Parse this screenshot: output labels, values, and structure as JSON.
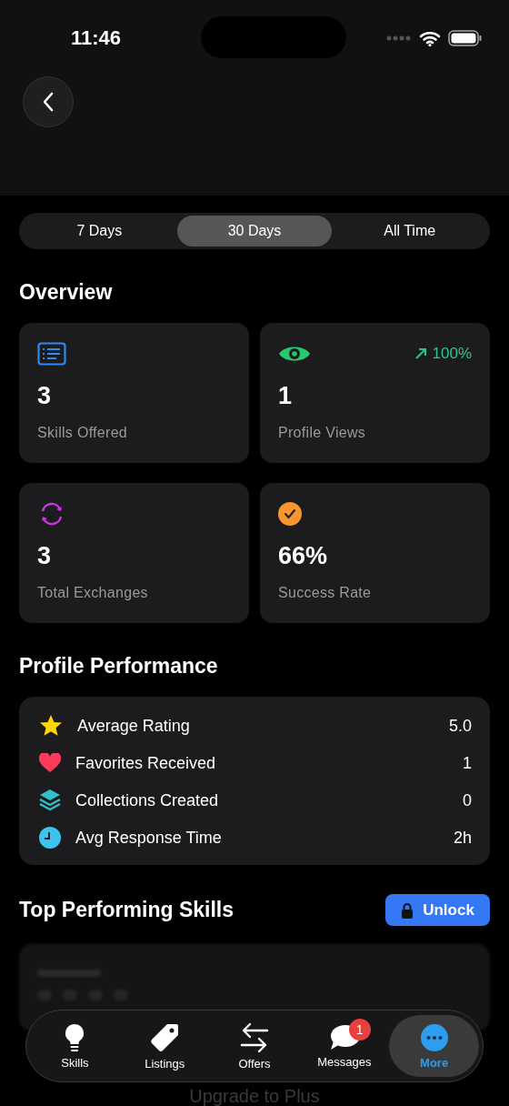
{
  "status_bar": {
    "time": "11:46"
  },
  "periods": [
    {
      "label": "7 Days",
      "selected": false
    },
    {
      "label": "30 Days",
      "selected": true
    },
    {
      "label": "All Time",
      "selected": false
    }
  ],
  "overview": {
    "title": "Overview",
    "stat_rows": [
      [
        {
          "kind": "list",
          "value": "3",
          "label": "Skills Offered"
        },
        {
          "kind": "eye",
          "value": "1",
          "label": "Profile Views",
          "trend": "100%"
        }
      ],
      [
        {
          "kind": "sync",
          "value": "3",
          "label": "Total Exchanges"
        },
        {
          "kind": "check",
          "value": "66%",
          "label": "Success Rate"
        }
      ]
    ]
  },
  "performance": {
    "title": "Profile Performance",
    "rows": [
      {
        "kind": "star",
        "label": "Average Rating",
        "value": "5.0"
      },
      {
        "kind": "heart",
        "label": "Favorites Received",
        "value": "1"
      },
      {
        "kind": "stack",
        "label": "Collections Created",
        "value": "0"
      },
      {
        "kind": "clock",
        "label": "Avg Response Time",
        "value": "2h"
      }
    ]
  },
  "top_skills": {
    "title": "Top Performing Skills",
    "unlock_label": "Unlock",
    "locked_message": "Upgrade to Plus"
  },
  "tab_bar": [
    {
      "kind": "bulb",
      "label": "Skills",
      "selected": false
    },
    {
      "kind": "tag",
      "label": "Listings",
      "selected": false
    },
    {
      "kind": "swap",
      "label": "Offers",
      "selected": false
    },
    {
      "kind": "chat",
      "label": "Messages",
      "selected": false,
      "badge": "1"
    },
    {
      "kind": "more",
      "label": "More",
      "selected": true
    }
  ]
}
